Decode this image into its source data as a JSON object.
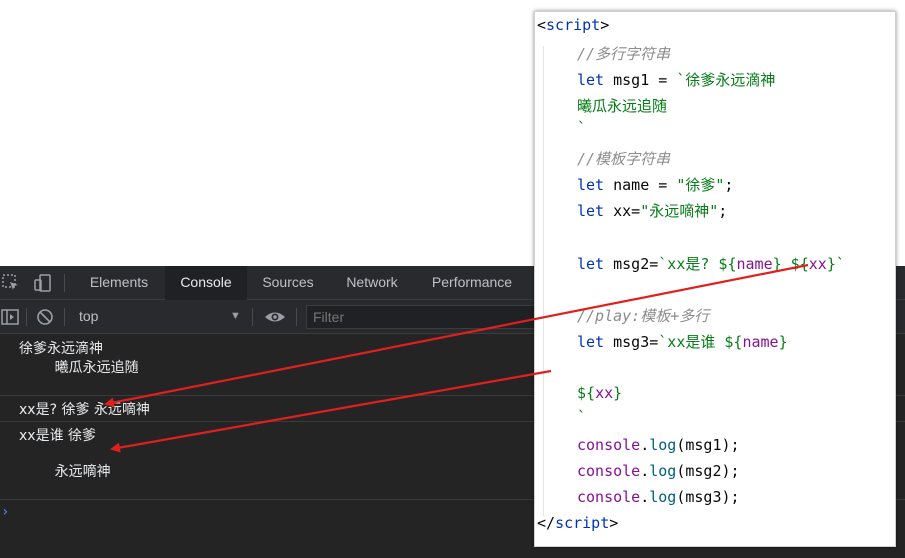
{
  "devtools": {
    "tabs": [
      "Elements",
      "Console",
      "Sources",
      "Network",
      "Performance"
    ],
    "active_tab": "Console",
    "toolbar": {
      "context": "top",
      "filter_placeholder": "Filter"
    },
    "console_output": [
      {
        "lines": [
          "徐爹永远滴神",
          "        曦瓜永远追随"
        ]
      },
      {
        "lines": [
          "xx是? 徐爹 永远嘀神"
        ]
      },
      {
        "lines": [
          "xx是谁 徐爹",
          "",
          "        永远嘀神"
        ]
      }
    ],
    "prompt_symbol": "›"
  },
  "code": {
    "open_tag": {
      "lt": "<",
      "name": "script",
      "gt": ">"
    },
    "comment1": "//多行字符串",
    "msg1_kw": "let",
    "msg1_decl": " msg1 = ",
    "msg1_str1": "`徐爹永远滴神",
    "msg1_str2": "曦瓜永远追随",
    "msg1_str3": "`",
    "comment2": "//模板字符串",
    "name_kw": "let",
    "name_decl": " name = ",
    "name_str": "\"徐爹\"",
    "semi": ";",
    "xx_kw": "let",
    "xx_decl": " xx=",
    "xx_str": "\"永远嘀神\"",
    "msg2_kw": "let",
    "msg2_decl": " msg2=",
    "msg2_str_a": "`xx是? ${",
    "msg2_var_a": "name",
    "msg2_str_b": "} ${",
    "msg2_var_b": "xx",
    "msg2_str_c": "}`",
    "comment3": "//play:模板+多行",
    "msg3_kw": "let",
    "msg3_decl": " msg3=",
    "msg3_str_a": "`xx是谁 ${",
    "msg3_var_a": "name",
    "msg3_str_b": "}",
    "msg3_str_c": "${",
    "msg3_var_b": "xx",
    "msg3_str_d": "}",
    "msg3_str_e": "`",
    "log_obj": "console",
    "log_dot": ".",
    "log_fn": "log",
    "log1_arg": "(msg1);",
    "log2_arg": "(msg2);",
    "log3_arg": "(msg3);",
    "close_tag": {
      "lt": "</",
      "name": "script",
      "gt": ">"
    }
  },
  "colors": {
    "arrow": "#e0201e",
    "keyword": "#0033b3",
    "string": "#067d17",
    "comment": "#8c8c8c",
    "variable": "#871094",
    "function": "#00627a"
  }
}
